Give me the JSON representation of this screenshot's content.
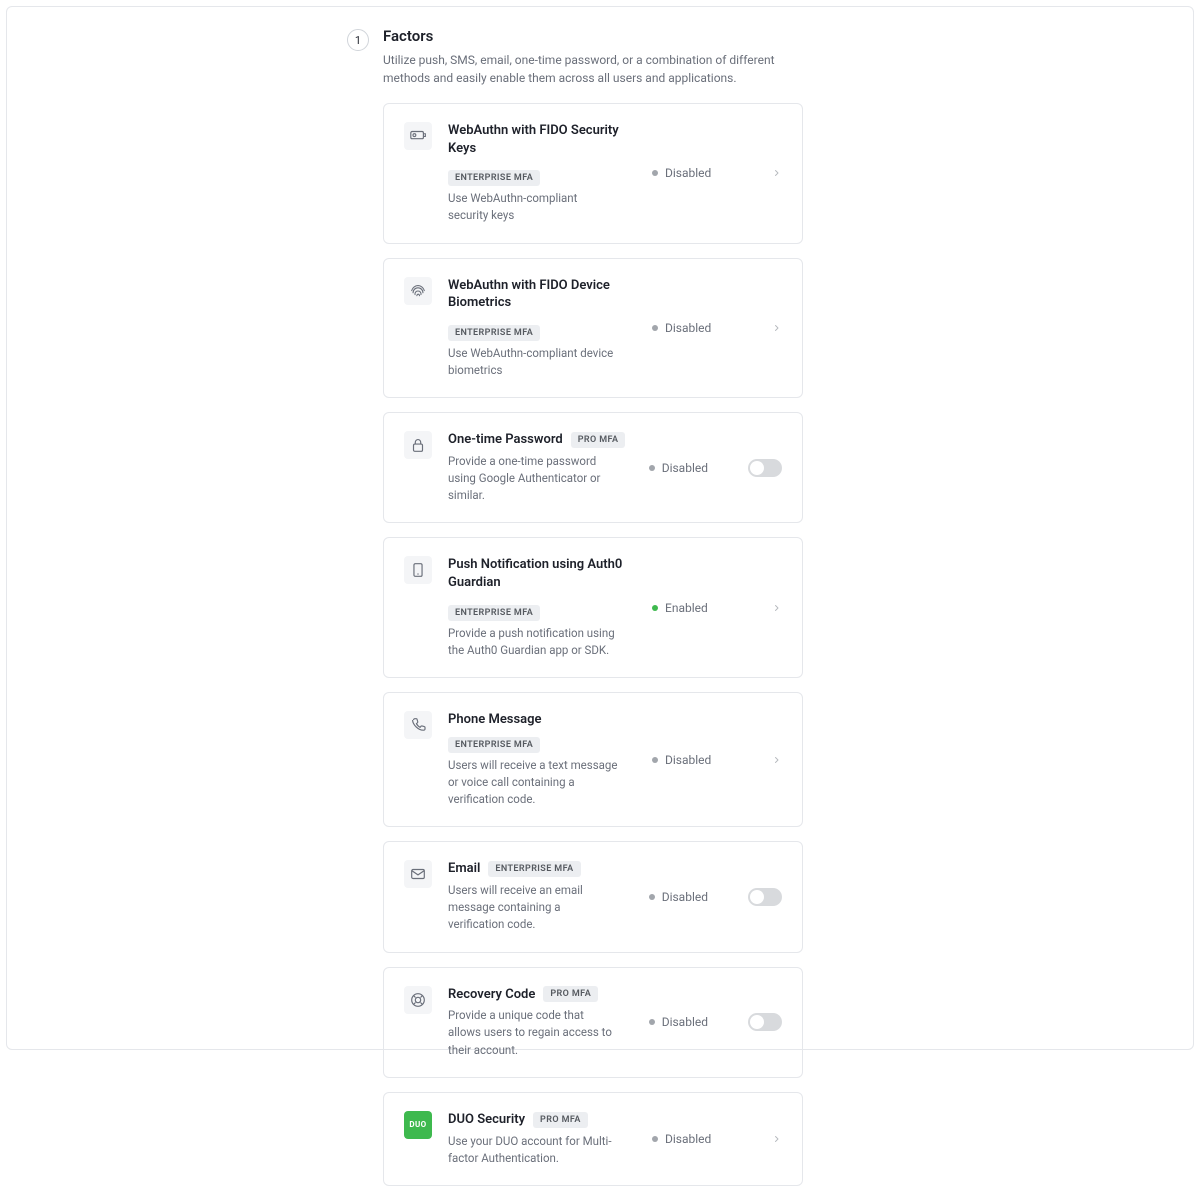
{
  "section": {
    "step": "1",
    "title": "Factors",
    "subtitle": "Utilize push, SMS, email, one-time password, or a combination of different methods and easily enable them across all users and applications."
  },
  "badges": {
    "enterprise": "ENTERPRISE MFA",
    "pro": "PRO MFA"
  },
  "status": {
    "enabled": "Enabled",
    "disabled": "Disabled"
  },
  "factors": [
    {
      "id": "webauthn-keys",
      "title": "WebAuthn with FIDO Security Keys",
      "badge": "enterprise",
      "badge_below": true,
      "description": "Use WebAuthn-compliant security keys",
      "enabled": false,
      "control": "chevron",
      "icon": "key-card"
    },
    {
      "id": "webauthn-bio",
      "title": "WebAuthn with FIDO Device Biometrics",
      "badge": "enterprise",
      "badge_below": true,
      "description": "Use WebAuthn-compliant device biometrics",
      "enabled": false,
      "control": "chevron",
      "icon": "fingerprint"
    },
    {
      "id": "otp",
      "title": "One-time Password",
      "badge": "pro",
      "badge_below": false,
      "description": "Provide a one-time password using Google Authenticator or similar.",
      "enabled": false,
      "control": "toggle",
      "icon": "lock"
    },
    {
      "id": "push",
      "title": "Push Notification using Auth0 Guardian",
      "badge": "enterprise",
      "badge_below": true,
      "description": "Provide a push notification using the Auth0 Guardian app or SDK.",
      "enabled": true,
      "control": "chevron",
      "icon": "phone-tablet"
    },
    {
      "id": "phone",
      "title": "Phone Message",
      "badge": "enterprise",
      "badge_below": false,
      "description": "Users will receive a text message or voice call containing a verification code.",
      "enabled": false,
      "control": "chevron",
      "icon": "phone"
    },
    {
      "id": "email",
      "title": "Email",
      "badge": "enterprise",
      "badge_below": false,
      "description": "Users will receive an email message containing a verification code.",
      "enabled": false,
      "control": "toggle",
      "icon": "mail"
    },
    {
      "id": "recovery",
      "title": "Recovery Code",
      "badge": "pro",
      "badge_below": false,
      "description": "Provide a unique code that allows users to regain access to their account.",
      "enabled": false,
      "control": "toggle",
      "icon": "lifebuoy"
    },
    {
      "id": "duo",
      "title": "DUO Security",
      "badge": "pro",
      "badge_below": false,
      "description": "Use your DUO account for Multi-factor Authentication.",
      "enabled": false,
      "control": "chevron",
      "icon": "duo"
    }
  ]
}
